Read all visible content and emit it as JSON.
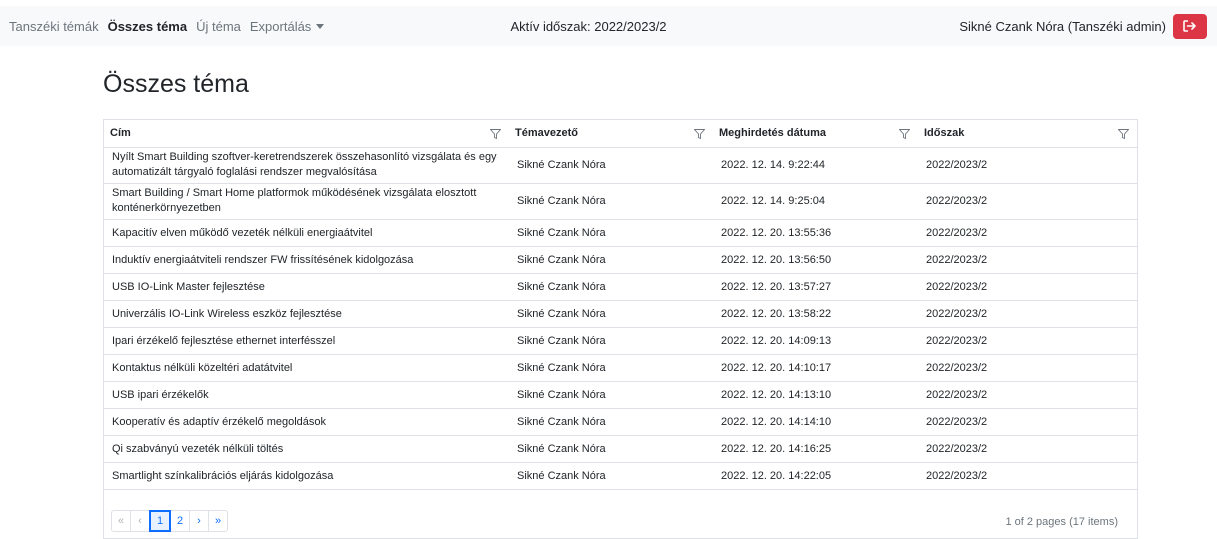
{
  "nav": {
    "links": [
      {
        "label": "Tanszéki témák",
        "active": false
      },
      {
        "label": "Összes téma",
        "active": true
      },
      {
        "label": "Új téma",
        "active": false
      }
    ],
    "export_label": "Exportálás",
    "active_period": "Aktív időszak: 2022/2023/2",
    "user": "Sikné Czank Nóra (Tanszéki admin)",
    "logout_color": "#dc3545"
  },
  "page": {
    "title": "Összes téma"
  },
  "table": {
    "columns": [
      "Cím",
      "Témavezető",
      "Meghirdetés dátuma",
      "Időszak"
    ],
    "rows": [
      {
        "cim": "Nyílt Smart Building szoftver-keretrendszerek összehasonlító vizsgálata és egy automatizált tárgyaló foglalási rendszer megvalósítása",
        "tv": "Sikné Czank Nóra",
        "date": "2022. 12. 14. 9:22:44",
        "period": "2022/2023/2"
      },
      {
        "cim": "Smart Building / Smart Home platformok működésének vizsgálata elosztott konténerkörnyezetben",
        "tv": "Sikné Czank Nóra",
        "date": "2022. 12. 14. 9:25:04",
        "period": "2022/2023/2"
      },
      {
        "cim": "Kapacitív elven működő vezeték nélküli energiaátvitel",
        "tv": "Sikné Czank Nóra",
        "date": "2022. 12. 20. 13:55:36",
        "period": "2022/2023/2"
      },
      {
        "cim": "Induktív energiaátviteli rendszer FW frissítésének kidolgozása",
        "tv": "Sikné Czank Nóra",
        "date": "2022. 12. 20. 13:56:50",
        "period": "2022/2023/2"
      },
      {
        "cim": "USB IO-Link Master fejlesztése",
        "tv": "Sikné Czank Nóra",
        "date": "2022. 12. 20. 13:57:27",
        "period": "2022/2023/2"
      },
      {
        "cim": "Univerzális IO-Link Wireless eszköz fejlesztése",
        "tv": "Sikné Czank Nóra",
        "date": "2022. 12. 20. 13:58:22",
        "period": "2022/2023/2"
      },
      {
        "cim": "Ipari érzékelő fejlesztése ethernet interfésszel",
        "tv": "Sikné Czank Nóra",
        "date": "2022. 12. 20. 14:09:13",
        "period": "2022/2023/2"
      },
      {
        "cim": "Kontaktus nélküli közeltéri adatátvitel",
        "tv": "Sikné Czank Nóra",
        "date": "2022. 12. 20. 14:10:17",
        "period": "2022/2023/2"
      },
      {
        "cim": "USB ipari érzékelők",
        "tv": "Sikné Czank Nóra",
        "date": "2022. 12. 20. 14:13:10",
        "period": "2022/2023/2"
      },
      {
        "cim": "Kooperatív és adaptív érzékelő megoldások",
        "tv": "Sikné Czank Nóra",
        "date": "2022. 12. 20. 14:14:10",
        "period": "2022/2023/2"
      },
      {
        "cim": "Qi szabványú vezeték nélküli töltés",
        "tv": "Sikné Czank Nóra",
        "date": "2022. 12. 20. 14:16:25",
        "period": "2022/2023/2"
      },
      {
        "cim": "Smartlight színkalibrációs eljárás kidolgozása",
        "tv": "Sikné Czank Nóra",
        "date": "2022. 12. 20. 14:22:05",
        "period": "2022/2023/2"
      }
    ]
  },
  "pager": {
    "first": "«",
    "prev": "‹",
    "pages": [
      "1",
      "2"
    ],
    "current": "1",
    "next": "›",
    "last": "»",
    "info": "1 of 2 pages (17 items)"
  }
}
